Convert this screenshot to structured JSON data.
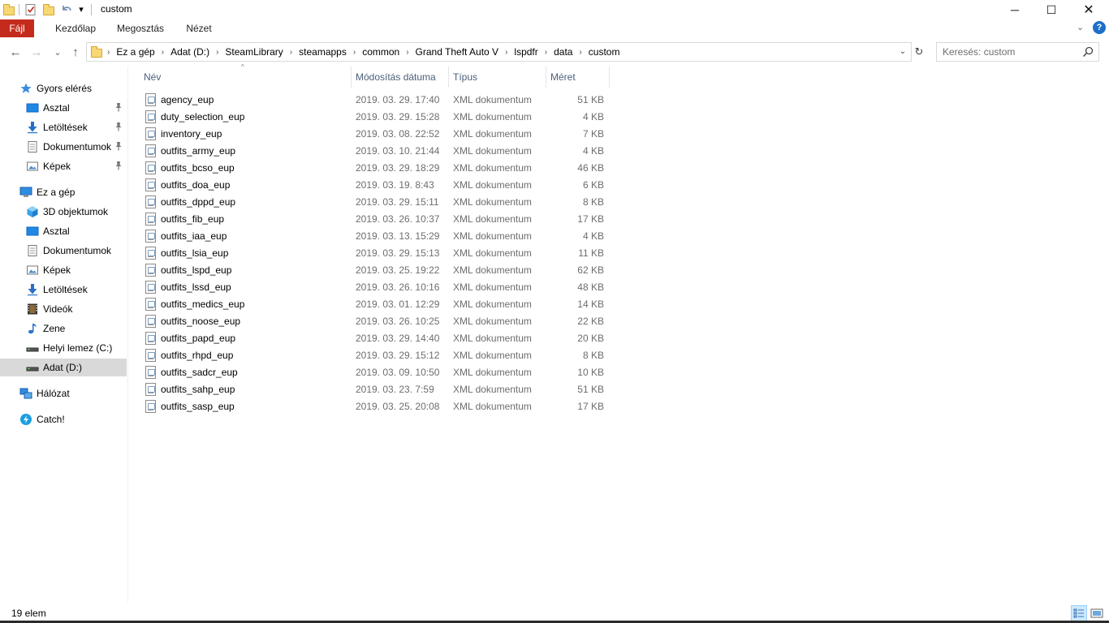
{
  "window": {
    "title": "custom",
    "controls": {
      "minimize": "─",
      "maximize": "☐",
      "close": "✕"
    }
  },
  "quick_access_toolbar": {
    "icons": [
      "folder-icon",
      "properties-icon",
      "new-folder-icon",
      "undo-icon",
      "customize-dropdown-icon"
    ],
    "dropdown_glyph": "▾"
  },
  "ribbon": {
    "tabs": [
      {
        "label": "Fájl",
        "active": false,
        "accent": "#c42b1c"
      },
      {
        "label": "Kezdőlap"
      },
      {
        "label": "Megosztás"
      },
      {
        "label": "Nézet"
      }
    ],
    "expand_glyph": "⌄",
    "help_glyph": "?"
  },
  "address": {
    "back_glyph": "←",
    "forward_glyph": "→",
    "recent_glyph": "⌄",
    "up_glyph": "↑",
    "breadcrumbs": [
      "Ez a gép",
      "Adat (D:)",
      "SteamLibrary",
      "steamapps",
      "common",
      "Grand Theft Auto V",
      "lspdfr",
      "data",
      "custom"
    ],
    "separator": "›",
    "dropdown_glyph": "⌄",
    "refresh_glyph": "↻"
  },
  "search": {
    "placeholder": "Keresés: custom"
  },
  "nav": {
    "items": [
      {
        "label": "Gyors elérés",
        "icon": "star-icon",
        "indent": 0,
        "pinned": false
      },
      {
        "label": "Asztal",
        "icon": "desktop-icon",
        "indent": 1,
        "pinned": true
      },
      {
        "label": "Letöltések",
        "icon": "download-icon",
        "indent": 1,
        "pinned": true
      },
      {
        "label": "Dokumentumok",
        "icon": "documents-icon",
        "indent": 1,
        "pinned": true
      },
      {
        "label": "Képek",
        "icon": "pictures-icon",
        "indent": 1,
        "pinned": true
      },
      {
        "label": "Ez a gép",
        "icon": "computer-icon",
        "indent": 0,
        "pinned": false
      },
      {
        "label": "3D objektumok",
        "icon": "cube-icon",
        "indent": 1,
        "pinned": false
      },
      {
        "label": "Asztal",
        "icon": "desktop-icon",
        "indent": 1,
        "pinned": false
      },
      {
        "label": "Dokumentumok",
        "icon": "documents-icon",
        "indent": 1,
        "pinned": false
      },
      {
        "label": "Képek",
        "icon": "pictures-icon",
        "indent": 1,
        "pinned": false
      },
      {
        "label": "Letöltések",
        "icon": "download-icon",
        "indent": 1,
        "pinned": false
      },
      {
        "label": "Videók",
        "icon": "video-icon",
        "indent": 1,
        "pinned": false
      },
      {
        "label": "Zene",
        "icon": "music-icon",
        "indent": 1,
        "pinned": false
      },
      {
        "label": "Helyi lemez (C:)",
        "icon": "drive-icon",
        "indent": 1,
        "pinned": false
      },
      {
        "label": "Adat (D:)",
        "icon": "drive-icon",
        "indent": 1,
        "pinned": false,
        "selected": true
      },
      {
        "label": "Hálózat",
        "icon": "network-icon",
        "indent": 0,
        "pinned": false
      },
      {
        "label": "Catch!",
        "icon": "catch-icon",
        "indent": 0,
        "pinned": false
      }
    ],
    "pin_glyph": "📌"
  },
  "columns": {
    "name": "Név",
    "modified": "Módosítás dátuma",
    "type": "Típus",
    "size": "Méret",
    "sort_glyph": "^"
  },
  "files": [
    {
      "name": "agency_eup",
      "modified": "2019. 03. 29. 17:40",
      "type": "XML dokumentum",
      "size": "51 KB"
    },
    {
      "name": "duty_selection_eup",
      "modified": "2019. 03. 29. 15:28",
      "type": "XML dokumentum",
      "size": "4 KB"
    },
    {
      "name": "inventory_eup",
      "modified": "2019. 03. 08. 22:52",
      "type": "XML dokumentum",
      "size": "7 KB"
    },
    {
      "name": "outfits_army_eup",
      "modified": "2019. 03. 10. 21:44",
      "type": "XML dokumentum",
      "size": "4 KB"
    },
    {
      "name": "outfits_bcso_eup",
      "modified": "2019. 03. 29. 18:29",
      "type": "XML dokumentum",
      "size": "46 KB"
    },
    {
      "name": "outfits_doa_eup",
      "modified": "2019. 03. 19. 8:43",
      "type": "XML dokumentum",
      "size": "6 KB"
    },
    {
      "name": "outfits_dppd_eup",
      "modified": "2019. 03. 29. 15:11",
      "type": "XML dokumentum",
      "size": "8 KB"
    },
    {
      "name": "outfits_fib_eup",
      "modified": "2019. 03. 26. 10:37",
      "type": "XML dokumentum",
      "size": "17 KB"
    },
    {
      "name": "outfits_iaa_eup",
      "modified": "2019. 03. 13. 15:29",
      "type": "XML dokumentum",
      "size": "4 KB"
    },
    {
      "name": "outfits_lsia_eup",
      "modified": "2019. 03. 29. 15:13",
      "type": "XML dokumentum",
      "size": "11 KB"
    },
    {
      "name": "outfits_lspd_eup",
      "modified": "2019. 03. 25. 19:22",
      "type": "XML dokumentum",
      "size": "62 KB"
    },
    {
      "name": "outfits_lssd_eup",
      "modified": "2019. 03. 26. 10:16",
      "type": "XML dokumentum",
      "size": "48 KB"
    },
    {
      "name": "outfits_medics_eup",
      "modified": "2019. 03. 01. 12:29",
      "type": "XML dokumentum",
      "size": "14 KB"
    },
    {
      "name": "outfits_noose_eup",
      "modified": "2019. 03. 26. 10:25",
      "type": "XML dokumentum",
      "size": "22 KB"
    },
    {
      "name": "outfits_papd_eup",
      "modified": "2019. 03. 29. 14:40",
      "type": "XML dokumentum",
      "size": "20 KB"
    },
    {
      "name": "outfits_rhpd_eup",
      "modified": "2019. 03. 29. 15:12",
      "type": "XML dokumentum",
      "size": "8 KB"
    },
    {
      "name": "outfits_sadcr_eup",
      "modified": "2019. 03. 09. 10:50",
      "type": "XML dokumentum",
      "size": "10 KB"
    },
    {
      "name": "outfits_sahp_eup",
      "modified": "2019. 03. 23. 7:59",
      "type": "XML dokumentum",
      "size": "51 KB"
    },
    {
      "name": "outfits_sasp_eup",
      "modified": "2019. 03. 25. 20:08",
      "type": "XML dokumentum",
      "size": "17 KB"
    }
  ],
  "status": {
    "item_count": "19 elem"
  },
  "colors": {
    "file_tab": "#c42b1c",
    "selected_nav": "#d9d9d9",
    "header_text": "#4c607a",
    "details_view_active": "#cce8ff"
  }
}
